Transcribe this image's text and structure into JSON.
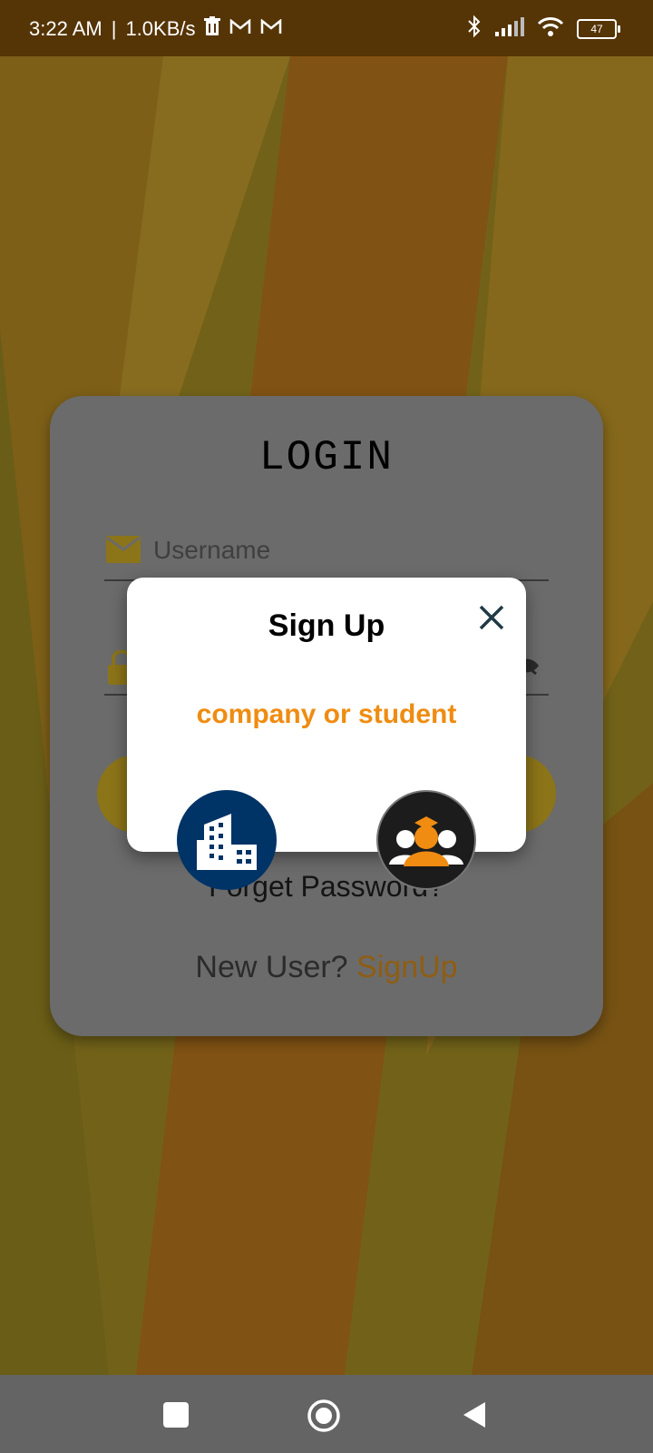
{
  "status_bar": {
    "time": "3:22 AM",
    "separator": "|",
    "speed": "1.0KB/s",
    "battery": "47"
  },
  "login": {
    "title": "LOGIN",
    "username_placeholder": "Username",
    "forget_password": "Forget Password?",
    "new_user_text": "New User?",
    "signup_link": "SignUp"
  },
  "dialog": {
    "title": "Sign Up",
    "subtitle": "company or student"
  },
  "colors": {
    "accent_orange": "#ef8c11",
    "company_circle": "#003366",
    "student_circle": "#1c1c1c",
    "status_bar": "#553406"
  },
  "icons": {
    "status": [
      "trash-icon",
      "gmail-icon",
      "gmail-icon",
      "bluetooth-icon",
      "signal-icon",
      "wifi-icon",
      "battery-icon"
    ],
    "nav": [
      "recents-icon",
      "home-icon",
      "back-icon"
    ]
  }
}
